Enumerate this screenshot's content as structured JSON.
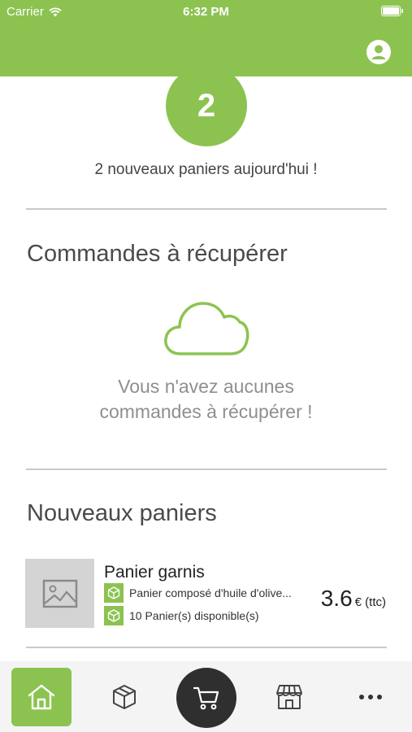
{
  "status_bar": {
    "carrier": "Carrier",
    "time": "6:32 PM",
    "icons": [
      "wifi-icon",
      "battery-icon"
    ]
  },
  "header": {
    "icons": [
      "profile-icon"
    ]
  },
  "new_baskets_badge": {
    "count": "2",
    "caption": "2 nouveaux paniers aujourd'hui !"
  },
  "orders_section": {
    "title": "Commandes à récupérer",
    "empty_icon": "cloud-icon",
    "empty_message": "Vous n'avez aucunes commandes à récupérer !"
  },
  "new_baskets_section": {
    "title": "Nouveaux paniers",
    "items": [
      {
        "name": "Panier garnis",
        "description": "Panier composé d'huile d'olive...",
        "availability": "10 Panier(s) disponible(s)",
        "price": "3.6",
        "price_unit": "€ (ttc)",
        "icons": [
          "image-placeholder-icon",
          "box-icon"
        ]
      }
    ]
  },
  "tab_bar": {
    "active": "home",
    "items": [
      "home-icon",
      "box-icon",
      "cart-icon",
      "shop-icon",
      "more-icon"
    ]
  },
  "colors": {
    "accent": "#8cc350",
    "dark": "#2f2f2f",
    "tabbar_bg": "#f4f4f4",
    "divider": "#c9c9c9"
  }
}
